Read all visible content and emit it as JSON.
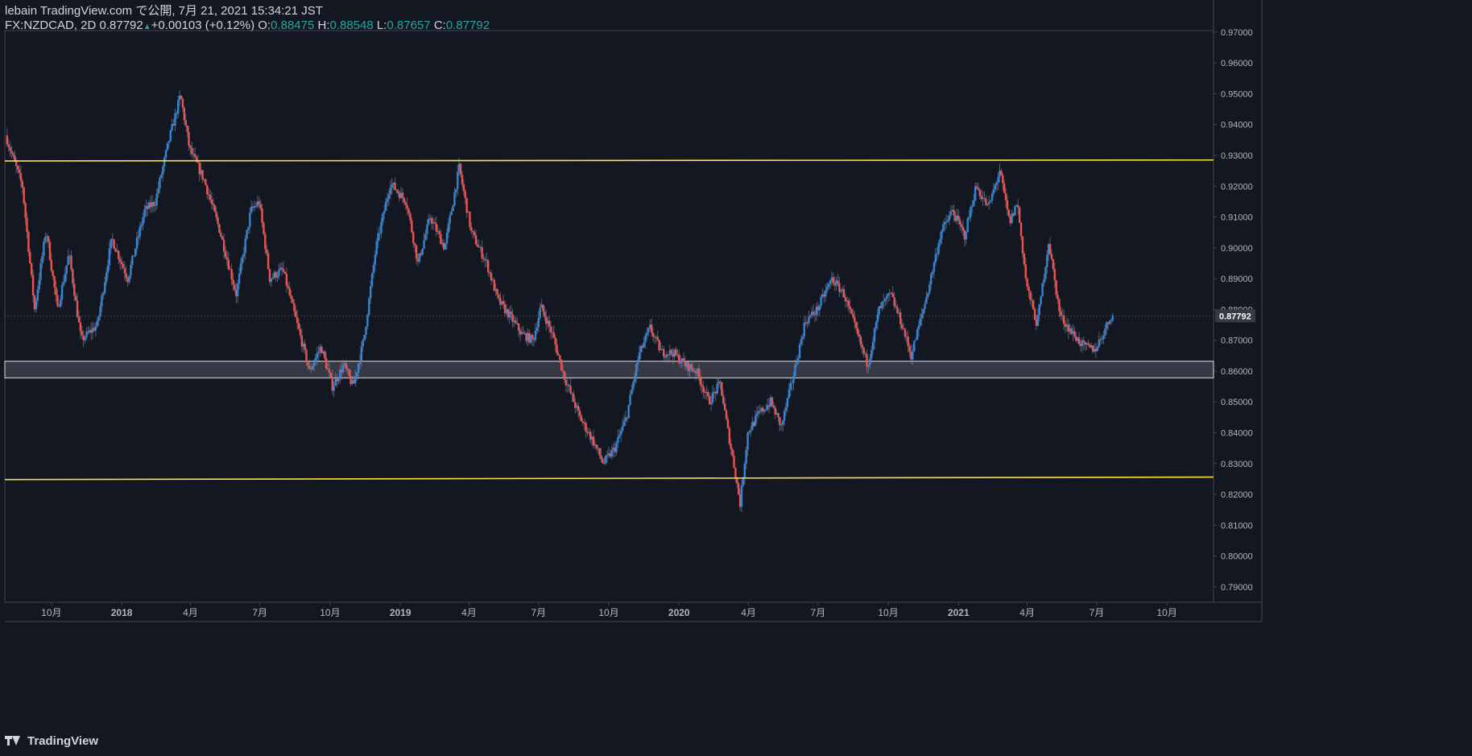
{
  "header": {
    "line1": "lebain TradingView.com で公開, 7月 21, 2021 15:34:21 JST",
    "symbol": "FX:NZDCAD, 2D 0.87792",
    "change": "+0.00103 (+0.12%)",
    "o_label": "O:",
    "o_value": "0.88475",
    "h_label": "H:",
    "h_value": "0.88548",
    "l_label": "L:",
    "l_value": "0.87657",
    "c_label": "C:",
    "c_value": "0.87792"
  },
  "footer": {
    "brand": "TradingView"
  },
  "colors": {
    "background": "#131722",
    "up": "#2e86de",
    "down": "#ef5350",
    "wick": "#8a8fa3",
    "level_line": "#fde047",
    "zone_fill": "#434651",
    "zone_border": "#e0e0e0",
    "axis_text": "#b2b5be",
    "price_label_bg": "#363a45",
    "highlight": "#26a69a"
  },
  "chart_data": {
    "type": "candlestick",
    "symbol": "FX:NZDCAD",
    "interval": "2D",
    "y_range": [
      0.785,
      0.9705
    ],
    "y_ticks": [
      "0.97000",
      "0.96000",
      "0.95000",
      "0.94000",
      "0.93000",
      "0.92000",
      "0.91000",
      "0.90000",
      "0.89000",
      "0.88000",
      "0.87000",
      "0.86000",
      "0.85000",
      "0.84000",
      "0.83000",
      "0.82000",
      "0.81000",
      "0.80000",
      "0.79000"
    ],
    "x_range": [
      "2017-08-01",
      "2021-12-01"
    ],
    "x_ticks": [
      {
        "date": "2017-10-01",
        "label": "10月"
      },
      {
        "date": "2018-01-01",
        "label": "2018"
      },
      {
        "date": "2018-04-01",
        "label": "4月"
      },
      {
        "date": "2018-07-01",
        "label": "7月"
      },
      {
        "date": "2018-10-01",
        "label": "10月"
      },
      {
        "date": "2019-01-01",
        "label": "2019"
      },
      {
        "date": "2019-04-01",
        "label": "4月"
      },
      {
        "date": "2019-07-01",
        "label": "7月"
      },
      {
        "date": "2019-10-01",
        "label": "10月"
      },
      {
        "date": "2020-01-01",
        "label": "2020"
      },
      {
        "date": "2020-04-01",
        "label": "4月"
      },
      {
        "date": "2020-07-01",
        "label": "7月"
      },
      {
        "date": "2020-10-01",
        "label": "10月"
      },
      {
        "date": "2021-01-01",
        "label": "2021"
      },
      {
        "date": "2021-04-01",
        "label": "4月"
      },
      {
        "date": "2021-07-01",
        "label": "7月"
      },
      {
        "date": "2021-10-01",
        "label": "10月"
      }
    ],
    "last_price": "0.87792",
    "last_price_value": 0.87792,
    "horizontal_lines": [
      {
        "price_start": 0.9282,
        "price_end": 0.9285
      },
      {
        "price_start": 0.8248,
        "price_end": 0.8256
      }
    ],
    "zone": {
      "top": 0.8632,
      "bottom": 0.8578
    },
    "price_path": [
      [
        "2017-08-03",
        0.9365
      ],
      [
        "2017-08-25",
        0.92
      ],
      [
        "2017-09-10",
        0.88
      ],
      [
        "2017-09-25",
        0.906
      ],
      [
        "2017-10-10",
        0.88
      ],
      [
        "2017-10-25",
        0.898
      ],
      [
        "2017-11-10",
        0.87
      ],
      [
        "2017-12-01",
        0.875
      ],
      [
        "2017-12-20",
        0.903
      ],
      [
        "2018-01-10",
        0.89
      ],
      [
        "2018-02-01",
        0.912
      ],
      [
        "2018-02-15",
        0.915
      ],
      [
        "2018-03-05",
        0.935
      ],
      [
        "2018-03-20",
        0.9495
      ],
      [
        "2018-04-01",
        0.932
      ],
      [
        "2018-04-20",
        0.922
      ],
      [
        "2018-05-10",
        0.906
      ],
      [
        "2018-06-01",
        0.885
      ],
      [
        "2018-06-20",
        0.912
      ],
      [
        "2018-07-01",
        0.915
      ],
      [
        "2018-07-15",
        0.89
      ],
      [
        "2018-08-01",
        0.893
      ],
      [
        "2018-08-20",
        0.875
      ],
      [
        "2018-09-05",
        0.86
      ],
      [
        "2018-09-20",
        0.868
      ],
      [
        "2018-10-05",
        0.855
      ],
      [
        "2018-10-20",
        0.862
      ],
      [
        "2018-11-01",
        0.855
      ],
      [
        "2018-11-15",
        0.87
      ],
      [
        "2018-12-01",
        0.9
      ],
      [
        "2018-12-20",
        0.921
      ],
      [
        "2019-01-10",
        0.915
      ],
      [
        "2019-01-25",
        0.895
      ],
      [
        "2019-02-10",
        0.91
      ],
      [
        "2019-03-01",
        0.9
      ],
      [
        "2019-03-20",
        0.926
      ],
      [
        "2019-04-05",
        0.905
      ],
      [
        "2019-04-25",
        0.895
      ],
      [
        "2019-05-10",
        0.883
      ],
      [
        "2019-05-25",
        0.878
      ],
      [
        "2019-06-10",
        0.872
      ],
      [
        "2019-06-25",
        0.87
      ],
      [
        "2019-07-05",
        0.881
      ],
      [
        "2019-07-20",
        0.872
      ],
      [
        "2019-08-05",
        0.858
      ],
      [
        "2019-08-25",
        0.845
      ],
      [
        "2019-09-10",
        0.838
      ],
      [
        "2019-09-25",
        0.83
      ],
      [
        "2019-10-10",
        0.835
      ],
      [
        "2019-10-25",
        0.845
      ],
      [
        "2019-11-10",
        0.865
      ],
      [
        "2019-11-25",
        0.874
      ],
      [
        "2019-12-10",
        0.866
      ],
      [
        "2019-12-25",
        0.866
      ],
      [
        "2020-01-10",
        0.862
      ],
      [
        "2020-01-25",
        0.86
      ],
      [
        "2020-02-10",
        0.85
      ],
      [
        "2020-02-25",
        0.856
      ],
      [
        "2020-03-05",
        0.842
      ],
      [
        "2020-03-15",
        0.828
      ],
      [
        "2020-03-22",
        0.817
      ],
      [
        "2020-04-01",
        0.84
      ],
      [
        "2020-04-15",
        0.846
      ],
      [
        "2020-05-01",
        0.85
      ],
      [
        "2020-05-15",
        0.842
      ],
      [
        "2020-06-01",
        0.86
      ],
      [
        "2020-06-15",
        0.876
      ],
      [
        "2020-07-01",
        0.88
      ],
      [
        "2020-07-20",
        0.89
      ],
      [
        "2020-08-05",
        0.885
      ],
      [
        "2020-08-25",
        0.87
      ],
      [
        "2020-09-05",
        0.862
      ],
      [
        "2020-09-20",
        0.88
      ],
      [
        "2020-10-05",
        0.885
      ],
      [
        "2020-10-20",
        0.875
      ],
      [
        "2020-11-01",
        0.865
      ],
      [
        "2020-11-20",
        0.883
      ],
      [
        "2020-12-10",
        0.905
      ],
      [
        "2020-12-25",
        0.912
      ],
      [
        "2021-01-10",
        0.904
      ],
      [
        "2021-01-25",
        0.92
      ],
      [
        "2021-02-10",
        0.913
      ],
      [
        "2021-02-25",
        0.925
      ],
      [
        "2021-03-10",
        0.908
      ],
      [
        "2021-03-20",
        0.915
      ],
      [
        "2021-04-01",
        0.888
      ],
      [
        "2021-04-15",
        0.875
      ],
      [
        "2021-04-30",
        0.902
      ],
      [
        "2021-05-15",
        0.878
      ],
      [
        "2021-06-01",
        0.872
      ],
      [
        "2021-06-15",
        0.868
      ],
      [
        "2021-06-30",
        0.867
      ],
      [
        "2021-07-10",
        0.872
      ],
      [
        "2021-07-21",
        0.878
      ]
    ]
  }
}
